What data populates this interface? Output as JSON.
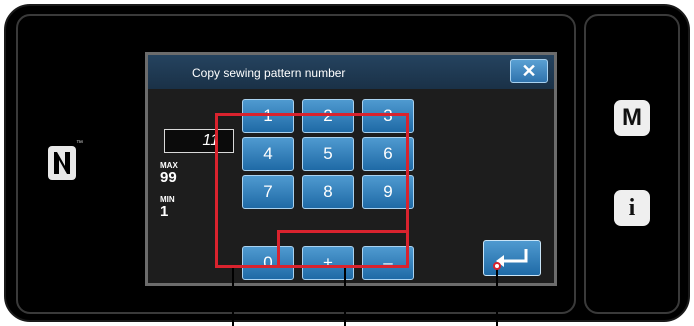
{
  "dialog": {
    "title": "Copy sewing pattern number",
    "close_symbol": "✕"
  },
  "input": {
    "value": "11",
    "max_label": "MAX",
    "max_value": "99",
    "min_label": "MIN",
    "min_value": "1"
  },
  "keypad": {
    "keys": [
      "1",
      "2",
      "3",
      "4",
      "5",
      "6",
      "7",
      "8",
      "9",
      "0",
      "+",
      "–"
    ]
  },
  "side": {
    "mode_button_label": "M",
    "info_button_label": "i"
  },
  "icons": {
    "nfc": "nfc-icon",
    "enter": "enter-icon",
    "close": "close-icon"
  },
  "colors": {
    "button_blue": "#2f73ad",
    "title_bar": "#1a3147",
    "highlight_red": "#d9232e"
  }
}
